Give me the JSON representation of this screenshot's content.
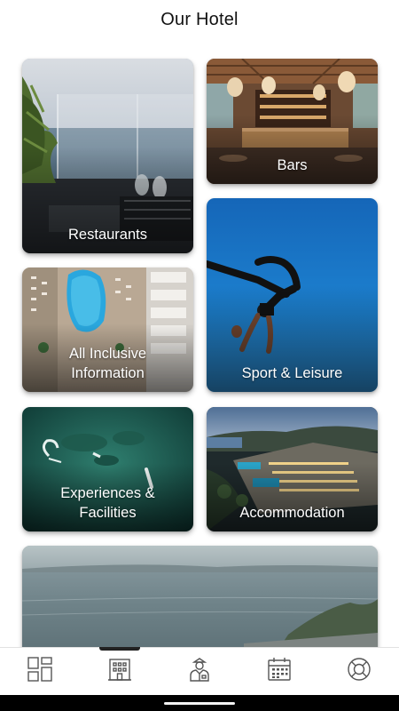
{
  "header": {
    "title": "Our Hotel"
  },
  "cards": {
    "restaurants": {
      "label": "Restaurants"
    },
    "bars": {
      "label": "Bars"
    },
    "sport": {
      "label": "Sport & Leisure"
    },
    "all_inclusive": {
      "label": "All Inclusive\nInformation"
    },
    "experiences": {
      "label": "Experiences &\nFacilities"
    },
    "accommodation": {
      "label": "Accommodation"
    },
    "sea_view": {
      "label": ""
    }
  },
  "bottom_nav": {
    "items": [
      {
        "icon": "dashboard-icon"
      },
      {
        "icon": "hotel-building-icon",
        "active": true
      },
      {
        "icon": "concierge-staff-icon"
      },
      {
        "icon": "calendar-icon"
      },
      {
        "icon": "lifebuoy-icon"
      }
    ]
  },
  "colors": {
    "accent": "#222222",
    "icon_stroke": "#555555"
  }
}
